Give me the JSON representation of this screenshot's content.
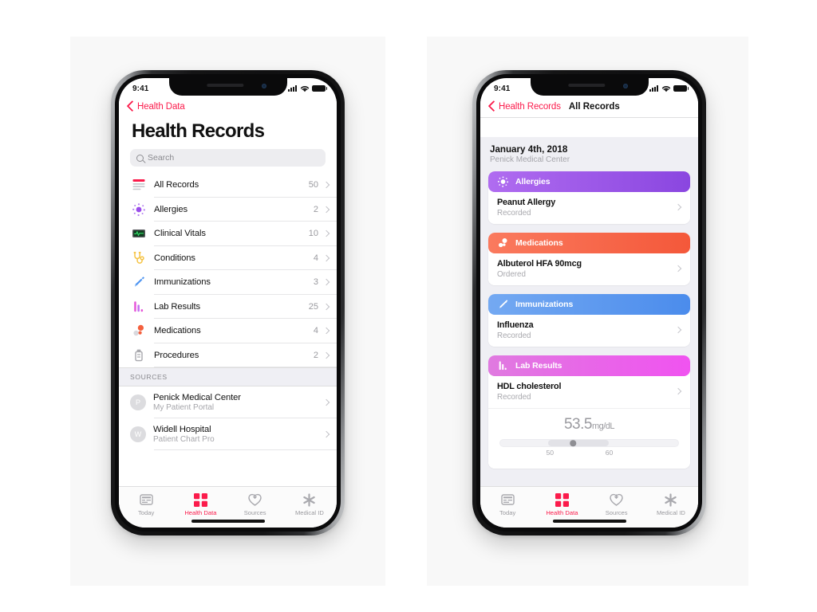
{
  "status_bar": {
    "time": "9:41",
    "signal_icon": "cellular-signal-icon",
    "wifi_icon": "wifi-icon",
    "battery_icon": "battery-icon"
  },
  "left_phone": {
    "nav": {
      "back_label": "Health Data",
      "back_icon": "chevron-left-icon"
    },
    "title": "Health Records",
    "search": {
      "placeholder": "Search",
      "icon": "search-icon"
    },
    "categories": [
      {
        "label": "All Records",
        "count": "50",
        "icon": "all-records-icon",
        "color": "#fb1b4b"
      },
      {
        "label": "Allergies",
        "count": "2",
        "icon": "allergies-icon",
        "color": "#9a4dea"
      },
      {
        "label": "Clinical Vitals",
        "count": "10",
        "icon": "clinical-vitals-icon",
        "color": "#2fbf5b"
      },
      {
        "label": "Conditions",
        "count": "4",
        "icon": "conditions-icon",
        "color": "#f5c344"
      },
      {
        "label": "Immunizations",
        "count": "3",
        "icon": "immunizations-icon",
        "color": "#3d8ef0"
      },
      {
        "label": "Lab Results",
        "count": "25",
        "icon": "lab-results-icon",
        "color": "#e655d8"
      },
      {
        "label": "Medications",
        "count": "4",
        "icon": "medications-icon",
        "color": "#f4603e"
      },
      {
        "label": "Procedures",
        "count": "2",
        "icon": "procedures-icon",
        "color": "#a8a8ad"
      }
    ],
    "sources_header": "SOURCES",
    "sources": [
      {
        "initial": "P",
        "title": "Penick Medical Center",
        "subtitle": "My Patient Portal"
      },
      {
        "initial": "W",
        "title": "Widell Hospital",
        "subtitle": "Patient Chart Pro"
      }
    ]
  },
  "right_phone": {
    "nav": {
      "back_label": "Health Records",
      "title": "All Records",
      "back_icon": "chevron-left-icon"
    },
    "date": "January 4th, 2018",
    "organization": "Penick Medical Center",
    "cards": [
      {
        "header": "Allergies",
        "icon": "allergies-icon",
        "gradient_from": "#b06cf0",
        "gradient_to": "#8a46e0",
        "item_title": "Peanut Allergy",
        "item_status": "Recorded"
      },
      {
        "header": "Medications",
        "icon": "medications-icon",
        "gradient_from": "#fa7a5e",
        "gradient_to": "#f4583a",
        "item_title": "Albuterol HFA 90mcg",
        "item_status": "Ordered"
      },
      {
        "header": "Immunizations",
        "icon": "immunizations-icon",
        "gradient_from": "#74a9f2",
        "gradient_to": "#4b8cec",
        "item_title": "Influenza",
        "item_status": "Recorded"
      },
      {
        "header": "Lab Results",
        "icon": "lab-results-icon",
        "gradient_from": "#e07ae0",
        "gradient_to": "#f053f0",
        "item_title": "HDL cholesterol",
        "item_status": "Recorded",
        "measurement": {
          "value": "53.5",
          "unit": "mg/dL",
          "tick_low": "50",
          "tick_high": "60"
        }
      }
    ]
  },
  "tab_bar": {
    "tabs": [
      {
        "label": "Today",
        "icon": "today-icon",
        "active": false
      },
      {
        "label": "Health Data",
        "icon": "health-data-icon",
        "active": true
      },
      {
        "label": "Sources",
        "icon": "sources-heart-icon",
        "active": false
      },
      {
        "label": "Medical ID",
        "icon": "medical-id-icon",
        "active": false
      }
    ]
  },
  "theme": {
    "accent": "#fb1b4b",
    "screen_bg": "#ffffff",
    "grouped_bg": "#efeff4",
    "panel_bg": "#f8f8f8"
  }
}
